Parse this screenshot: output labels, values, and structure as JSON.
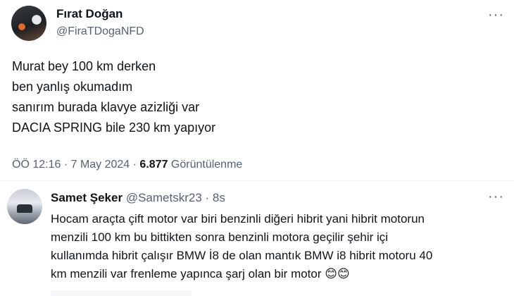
{
  "main_tweet": {
    "author_name": "Fırat Doğan",
    "author_handle": "@FiraTDogaNFD",
    "more_icon": "more-horizontal-icon",
    "lines": [
      "Murat bey 100 km derken",
      "ben yanlış okumadım",
      "sanırım burada klavye azizliği var",
      "DACIA SPRING bile 230 km yapıyor"
    ],
    "timestamp": "ÖÖ 12:16 · 7 May 2024",
    "dot": " · ",
    "views_count": "6.877",
    "views_label": " Görüntülenme"
  },
  "reply": {
    "author_name": "Samet Şeker",
    "author_handle": "@Sametskr23",
    "separator": " · ",
    "time": "8s",
    "more_icon": "more-horizontal-icon",
    "lines": [
      "Hocam araçta çift motor var biri benzinli diğeri hibrit yani hibrit motorun",
      "menzili 100 km bu bittikten sonra benzinli motora geçilir şehir içi",
      "kullanımda hibrit çalışır BMW İ8 de olan mantık BMW i8 hibrit motoru 40",
      "km menzili var frenleme yapınca şarj olan bir motor 😊😊"
    ]
  }
}
